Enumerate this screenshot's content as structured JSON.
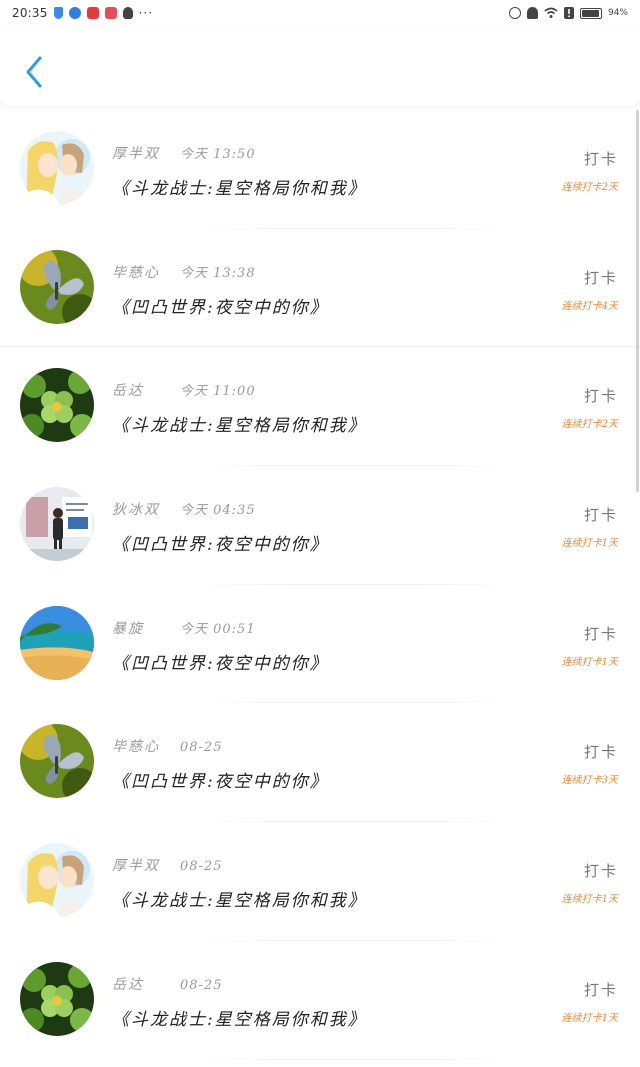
{
  "status_bar": {
    "time": "20:35",
    "more": "···",
    "battery_text": "94%",
    "battery_level": 0.94
  },
  "rows": [
    {
      "username": "厚半双",
      "time": "今天 13:50",
      "title": "《斗龙战士:星空格局你和我》",
      "action": "打卡",
      "streak": "连续打卡2天",
      "avatar": "anime-couple"
    },
    {
      "username": "毕慈心",
      "time": "今天 13:38",
      "title": "《凹凸世界:夜空中的你》",
      "action": "打卡",
      "streak": "连续打卡4天",
      "avatar": "butterfly"
    },
    {
      "username": "岳达",
      "time": "今天 11:00",
      "title": "《斗龙战士:星空格局你和我》",
      "action": "打卡",
      "streak": "连续打卡2天",
      "avatar": "clover"
    },
    {
      "username": "狄冰双",
      "time": "今天 04:35",
      "title": "《凹凸世界:夜空中的你》",
      "action": "打卡",
      "streak": "连续打卡1天",
      "avatar": "person-photo"
    },
    {
      "username": "暴旋",
      "time": "今天 00:51",
      "title": "《凹凸世界:夜空中的你》",
      "action": "打卡",
      "streak": "连续打卡1天",
      "avatar": "beach"
    },
    {
      "username": "毕慈心",
      "time": "08-25",
      "title": "《凹凸世界:夜空中的你》",
      "action": "打卡",
      "streak": "连续打卡3天",
      "avatar": "butterfly"
    },
    {
      "username": "厚半双",
      "time": "08-25",
      "title": "《斗龙战士:星空格局你和我》",
      "action": "打卡",
      "streak": "连续打卡1天",
      "avatar": "anime-couple"
    },
    {
      "username": "岳达",
      "time": "08-25",
      "title": "《斗龙战士:星空格局你和我》",
      "action": "打卡",
      "streak": "连续打卡1天",
      "avatar": "clover"
    }
  ],
  "colors": {
    "accent": "#2d9be8",
    "streak": "#e48a3a",
    "title": "#222222",
    "meta": "#9a9a9a"
  }
}
